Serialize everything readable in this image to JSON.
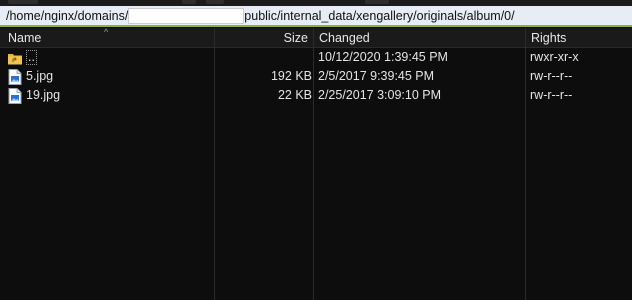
{
  "path": {
    "prefix": "/home/nginx/domains/",
    "suffix": "public/internal_data/xengallery/originals/album/0/"
  },
  "columns": {
    "name": "Name",
    "size": "Size",
    "changed": "Changed",
    "rights": "Rights"
  },
  "files": [
    {
      "name": "..",
      "size": "",
      "changed": "10/12/2020 1:39:45 PM",
      "rights": "rwxr-xr-x",
      "icon": "parent-folder-icon"
    },
    {
      "name": "5.jpg",
      "size": "192 KB",
      "changed": "2/5/2017 9:39:45 PM",
      "rights": "rw-r--r--",
      "icon": "image-file-icon"
    },
    {
      "name": "19.jpg",
      "size": "22 KB",
      "changed": "2/25/2017 3:09:10 PM",
      "rights": "rw-r--r--",
      "icon": "image-file-icon"
    }
  ],
  "colors": {
    "path_underline": "#8fb33a",
    "folder": "#e8b437",
    "file_icon": "#2f6fd1"
  }
}
